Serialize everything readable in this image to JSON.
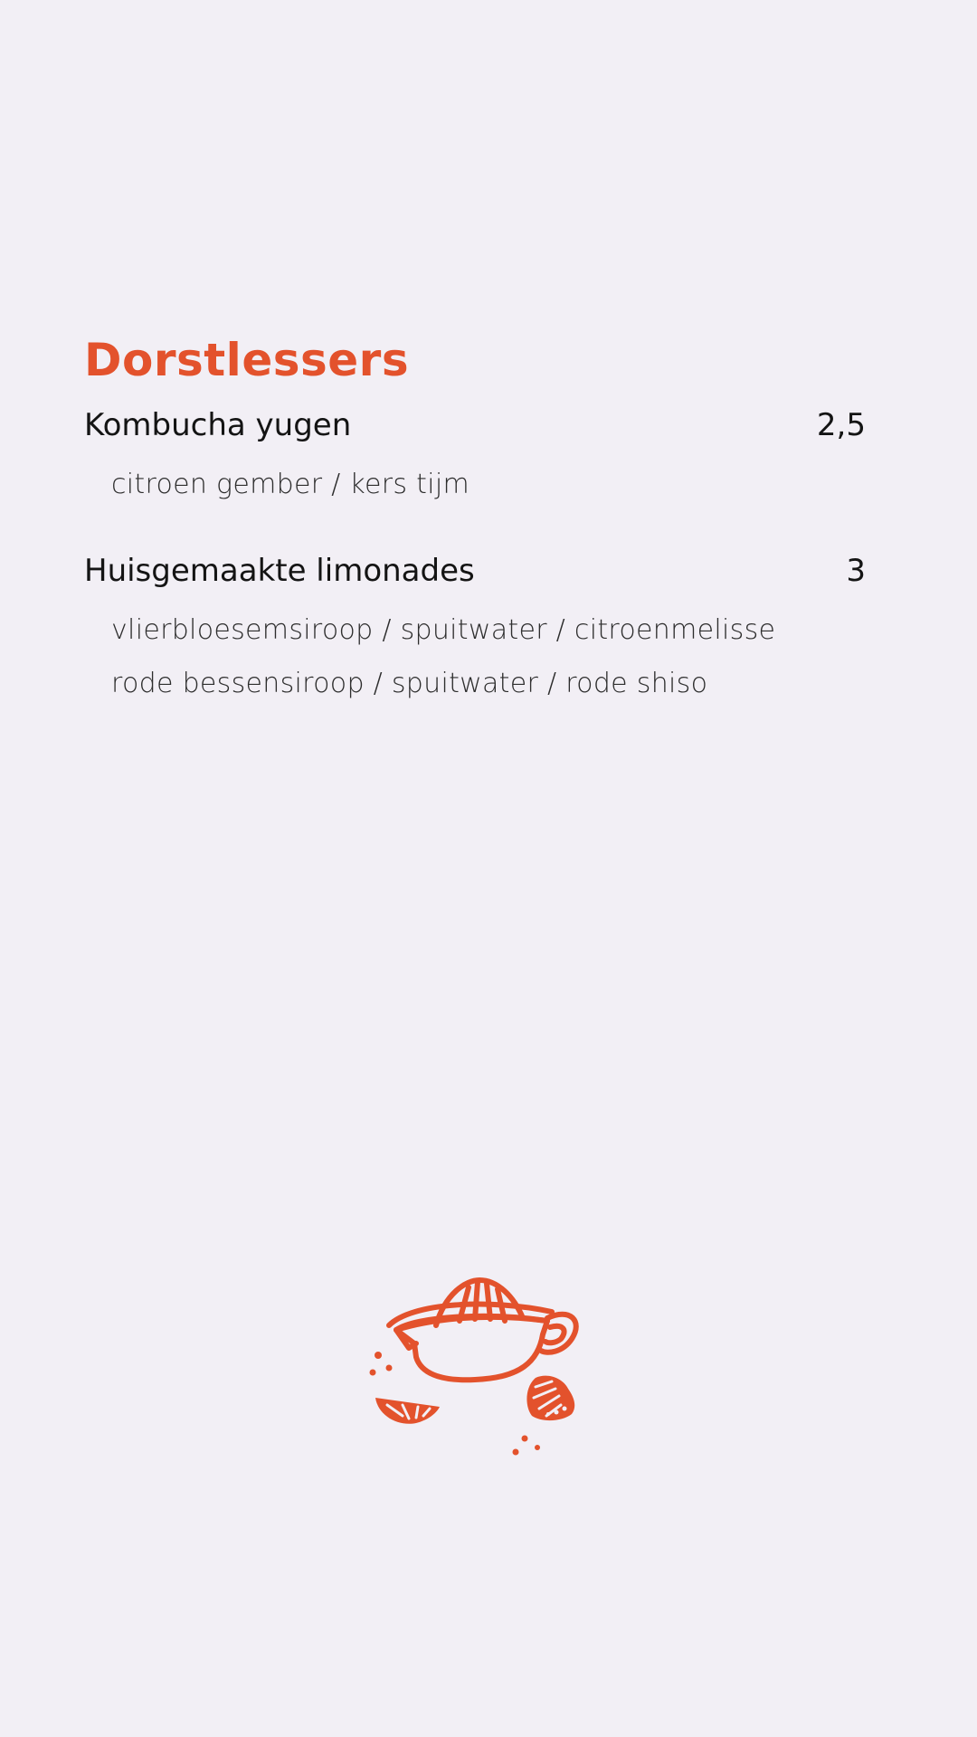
{
  "section": {
    "title": "Dorstlessers",
    "items": [
      {
        "name": "Kombucha yugen",
        "price": "2,5",
        "descriptions": [
          "citroen gember / kers tijm"
        ]
      },
      {
        "name": "Huisgemaakte limonades",
        "price": "3",
        "descriptions": [
          "vlierbloesemsiroop / spuitwater / citroenmelisse",
          "rode bessensiroop / spuitwater / rode shiso"
        ]
      }
    ]
  },
  "colors": {
    "background": "#f2eff5",
    "accent": "#e3522c",
    "text": "#141414"
  },
  "illustration": {
    "icon": "citrus-juicer-icon"
  }
}
